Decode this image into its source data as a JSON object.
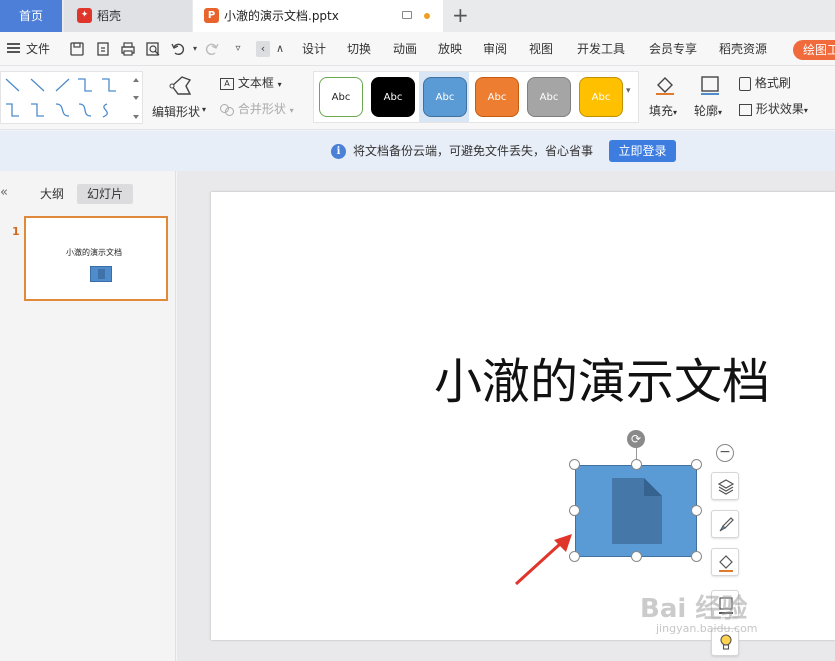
{
  "tabs": {
    "home": "首页",
    "daoke": "稻壳",
    "file_name": "小澈的演示文档.pptx",
    "new_tab": "+"
  },
  "menu": {
    "file": "文件",
    "items": [
      "设计",
      "切换",
      "动画",
      "放映",
      "审阅",
      "视图",
      "开发工具",
      "会员专享",
      "稻壳资源"
    ],
    "drawing_tools": "绘图工"
  },
  "ribbon": {
    "edit_shape": "编辑形状",
    "text_box": "文本框",
    "merge_shape": "合并形状",
    "style_label": "Abc",
    "styles": [
      {
        "bg": "#ffffff",
        "fg": "#222222",
        "border": "#6aa84f"
      },
      {
        "bg": "#000000",
        "fg": "#ffffff",
        "border": "#000000"
      },
      {
        "bg": "#5b9bd5",
        "fg": "#ffffff",
        "border": "#41719c"
      },
      {
        "bg": "#ed7d31",
        "fg": "#ffffff",
        "border": "#c55a11"
      },
      {
        "bg": "#a5a5a5",
        "fg": "#ffffff",
        "border": "#7f7f7f"
      },
      {
        "bg": "#ffc000",
        "fg": "#ffffff",
        "border": "#bf9000"
      }
    ],
    "fill": "填充",
    "outline": "轮廓",
    "format_painter": "格式刷",
    "shape_effects": "形状效果"
  },
  "notice": {
    "text": "将文档备份云端，可避免文件丢失，省心省事",
    "login_button": "立即登录"
  },
  "left_panel": {
    "tab_outline": "大纲",
    "tab_slides": "幻灯片",
    "slide_number": "1",
    "thumb_title": "小澈的演示文档"
  },
  "slide": {
    "title": "小澈的演示文档"
  },
  "watermark": {
    "main": "Bai 经验",
    "sub": "jingyan.baidu.com"
  },
  "colors": {
    "accent_blue": "#4d7fd9",
    "shape_fill": "#5b9bd5",
    "thumb_border": "#e0893a",
    "arrow_red": "#e0352b"
  }
}
